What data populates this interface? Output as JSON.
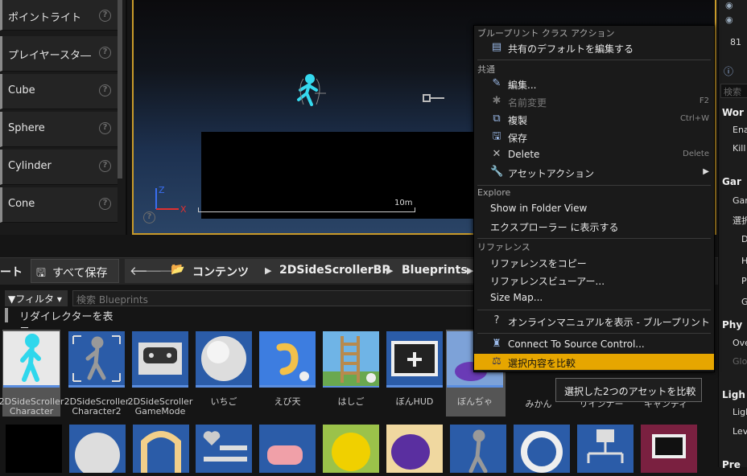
{
  "left_panel": {
    "items": [
      {
        "label": "ポイントライト"
      },
      {
        "label": "プレイヤースタ―"
      },
      {
        "label": "Cube"
      },
      {
        "label": "Sphere"
      },
      {
        "label": "Cylinder"
      },
      {
        "label": "Cone"
      }
    ]
  },
  "viewport": {
    "ruler_label": "10m",
    "axis_z": "Z",
    "axis_x": "X"
  },
  "right_panel": {
    "top_number": "81",
    "search_placeholder": "検索",
    "rows": [
      "Wor",
      "Ena",
      "Kill",
      "Gar",
      "Gan",
      "選択",
      "De",
      "H",
      "P",
      "G",
      "Phy",
      "Ove",
      "Glob",
      "Ligh",
      "Ligh",
      "Lev",
      "Pre"
    ]
  },
  "toolbar": {
    "left_cut": "ート",
    "save_all": "すべて保存",
    "breadcrumbs": [
      "コンテンツ",
      "2DSideScrollerBP",
      "Blueprints"
    ]
  },
  "filter": {
    "label": "フィルタ",
    "search_placeholder": "検索 Blueprints",
    "redirect_label": "リダイレクターを表示"
  },
  "assets": [
    {
      "name": "2DSideScroller Character",
      "selected": true
    },
    {
      "name": "2DSideScroller Character2",
      "selected": false
    },
    {
      "name": "2DSideScroller GameMode",
      "selected": false
    },
    {
      "name": "いちご",
      "selected": false
    },
    {
      "name": "えび天",
      "selected": false
    },
    {
      "name": "はしご",
      "selected": false
    },
    {
      "name": "ぼんHUD",
      "selected": false
    },
    {
      "name": "ぼんぢゃ",
      "selected": true
    },
    {
      "name": "みかん",
      "selected": false
    },
    {
      "name": "リインナー",
      "selected": false
    },
    {
      "name": "キャンディ",
      "selected": false
    }
  ],
  "context_menu": {
    "sections": {
      "blueprint": "ブループリント クラス アクション",
      "common": "共通",
      "explore": "Explore",
      "references": "リファレンス"
    },
    "items": {
      "edit_defaults": "共有のデフォルトを編集する",
      "edit": "編集...",
      "rename": "名前変更",
      "rename_sc": "F2",
      "duplicate": "複製",
      "duplicate_sc": "Ctrl+W",
      "save": "保存",
      "delete": "Delete",
      "delete_sc": "Delete",
      "asset_actions": "アセットアクション",
      "show_folder": "Show in Folder View",
      "show_explorer": "エクスプローラー に表示する",
      "copy_ref": "リファレンスをコピー",
      "ref_viewer": "リファレンスビューアー...",
      "size_map": "Size Map...",
      "online_manual": "オンラインマニュアルを表示 - ブループリント",
      "source_control": "Connect To Source Control...",
      "diff": "選択内容を比較"
    },
    "tooltip": "選択した2つのアセットを比較"
  },
  "colors": {
    "accent": "#e6a600",
    "selection": "#555555",
    "asset_bg": "#2b5ca8"
  }
}
